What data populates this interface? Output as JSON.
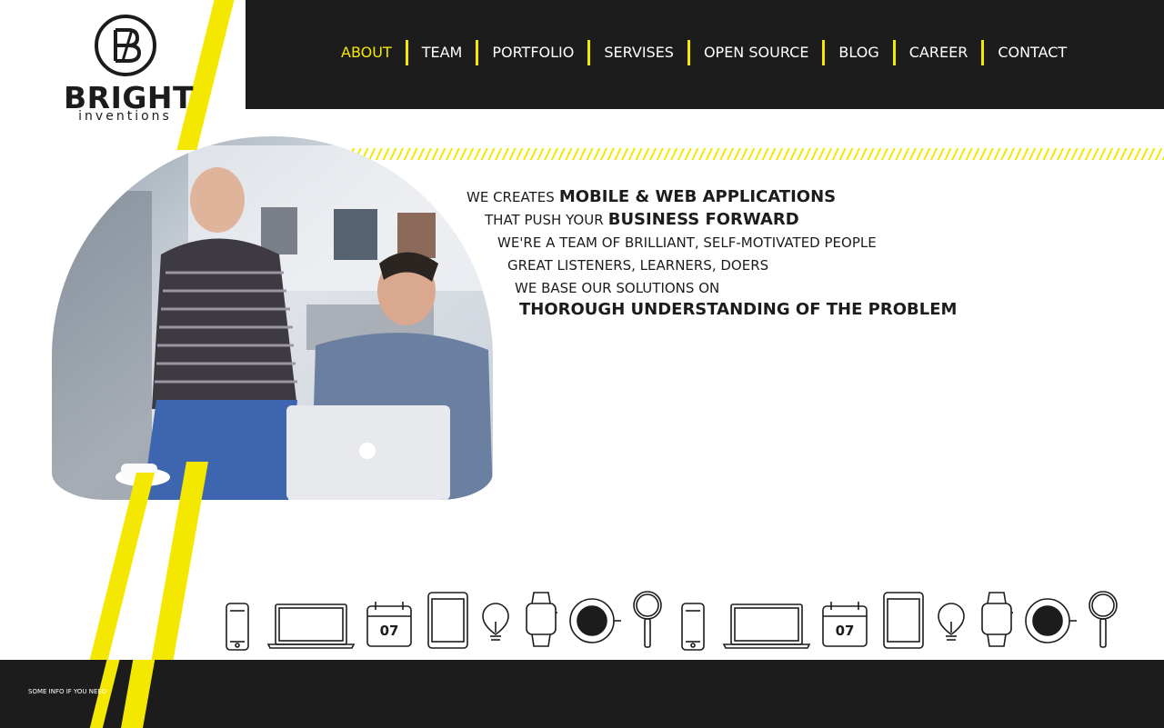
{
  "brand": {
    "name": "BRIGHT",
    "subtitle": "inventions"
  },
  "colors": {
    "accent": "#f5e800",
    "dark": "#1c1c1c",
    "background": "#ffffff"
  },
  "nav": {
    "items": [
      {
        "label": "ABOUT",
        "active": true
      },
      {
        "label": "TEAM",
        "active": false
      },
      {
        "label": "PORTFOLIO",
        "active": false
      },
      {
        "label": "SERVISES",
        "active": false
      },
      {
        "label": "OPEN SOURCE",
        "active": false
      },
      {
        "label": "BLOG",
        "active": false
      },
      {
        "label": "CAREER",
        "active": false
      },
      {
        "label": "CONTACT",
        "active": false
      }
    ]
  },
  "hero": {
    "photo_alt": "two-men-at-laptop-photo",
    "tagline": {
      "line1_small": "WE CREATES",
      "line1_big": "MOBILE & WEB APPLICATIONS",
      "line2_small": "THAT PUSH YOUR",
      "line2_big": "BUSINESS FORWARD",
      "line3": "WE'RE A TEAM OF BRILLIANT, SELF-MOTIVATED PEOPLE",
      "line4": "GREAT LISTENERS, LEARNERS, DOERS",
      "line5": "WE BASE OUR SOLUTIONS ON",
      "line6": "THOROUGH UNDERSTANDING OF THE PROBLEM"
    }
  },
  "icon_strip": {
    "calendar_day": "07",
    "icons": [
      "phone-icon",
      "laptop-icon",
      "calendar-icon",
      "tablet-icon",
      "lightbulb-icon",
      "smartwatch-icon",
      "coffee-cup-icon",
      "magnifier-icon"
    ]
  },
  "footer": {
    "text": "SOME INFO IF YOU NEED"
  }
}
